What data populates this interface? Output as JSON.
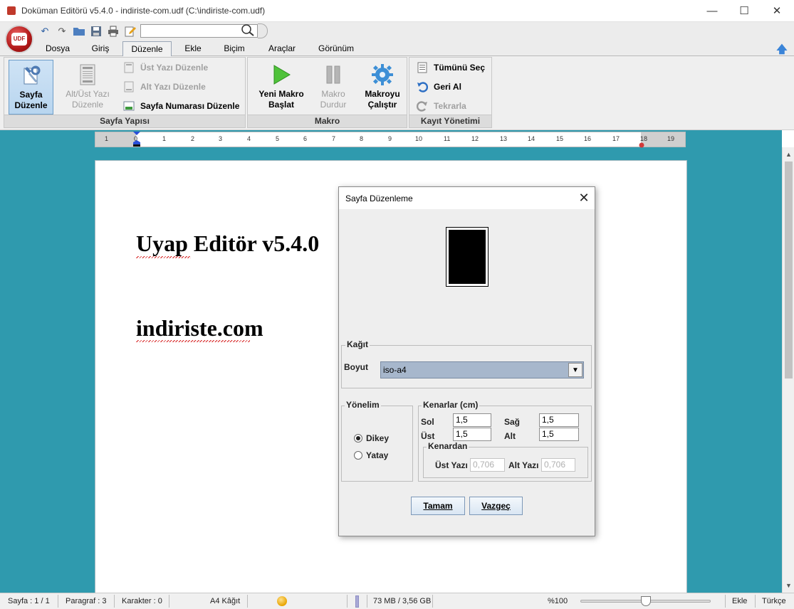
{
  "window": {
    "title": "Doküman Editörü v5.4.0 - indiriste-com.udf (C:\\indiriste-com.udf)",
    "minimize": "—",
    "maximize": "☐",
    "close": "✕"
  },
  "logo": {
    "text": "UDF"
  },
  "quick_access": {
    "search_value": "",
    "icons": [
      "undo-icon",
      "redo-icon",
      "open-folder-icon",
      "save-icon",
      "print-icon",
      "edit-icon"
    ]
  },
  "tabs": [
    {
      "label": "Dosya"
    },
    {
      "label": "Giriş"
    },
    {
      "label": "Düzenle"
    },
    {
      "label": "Ekle"
    },
    {
      "label": "Biçim"
    },
    {
      "label": "Araçlar"
    },
    {
      "label": "Görünüm"
    }
  ],
  "ribbon": {
    "page_layout": {
      "label": "Sayfa Yapısı",
      "sayfa_duzenle": "Sayfa Düzenle",
      "alt_ust_yazi": "Alt/Üst Yazı Düzenle",
      "ust_yazi": "Üst Yazı Düzenle",
      "alt_yazi": "Alt Yazı Düzenle",
      "sayfa_numarasi": "Sayfa Numarası Düzenle"
    },
    "macro": {
      "label": "Makro",
      "yeni_makro": "Yeni Makro Başlat",
      "makro_durdur": "Makro Durdur",
      "makroyu_calistir": "Makroyu Çalıştır"
    },
    "history": {
      "label": "Kayıt Yönetimi",
      "tumunu_sec": "Tümünü Seç",
      "geri_al": "Geri Al",
      "tekrarla": "Tekrarla"
    }
  },
  "ruler": {
    "ticks": [
      "1",
      "0",
      "1",
      "2",
      "3",
      "4",
      "5",
      "6",
      "7",
      "8",
      "9",
      "10",
      "11",
      "12",
      "13",
      "14",
      "15",
      "16",
      "17",
      "18",
      "19"
    ]
  },
  "document": {
    "heading1": "Uyap Editör v5.4.0",
    "heading2": "indiriste.com"
  },
  "status": {
    "sayfa": "Sayfa : 1 / 1",
    "paragraf": "Paragraf : 3",
    "karakter": "Karakter : 0",
    "kagit": "A4 Kâğıt",
    "memory": "73 MB / 3,56 GB",
    "zoom": "%100",
    "zoom_level_percent": 50,
    "mode": "Ekle",
    "language": "Türkçe"
  },
  "dialog": {
    "title": "Sayfa Düzenleme",
    "close": "✕",
    "kagit": {
      "legend": "Kağıt",
      "boyut_label": "Boyut",
      "boyut_value": "iso-a4"
    },
    "yonelim": {
      "legend": "Yönelim",
      "dikey": "Dikey",
      "yatay": "Yatay",
      "selected": "Dikey"
    },
    "kenarlar": {
      "legend": "Kenarlar (cm)",
      "sol_label": "Sol",
      "sol_value": "1,5",
      "sag_label": "Sağ",
      "sag_value": "1,5",
      "ust_label": "Üst",
      "ust_value": "1,5",
      "alt_label": "Alt",
      "alt_value": "1,5"
    },
    "kenardan": {
      "legend": "Kenardan",
      "ust_yazi_label": "Üst Yazı",
      "ust_yazi_value": "0,706",
      "alt_yazi_label": "Alt Yazı",
      "alt_yazi_value": "0,706"
    },
    "ok": "Tamam",
    "cancel": "Vazgeç"
  }
}
